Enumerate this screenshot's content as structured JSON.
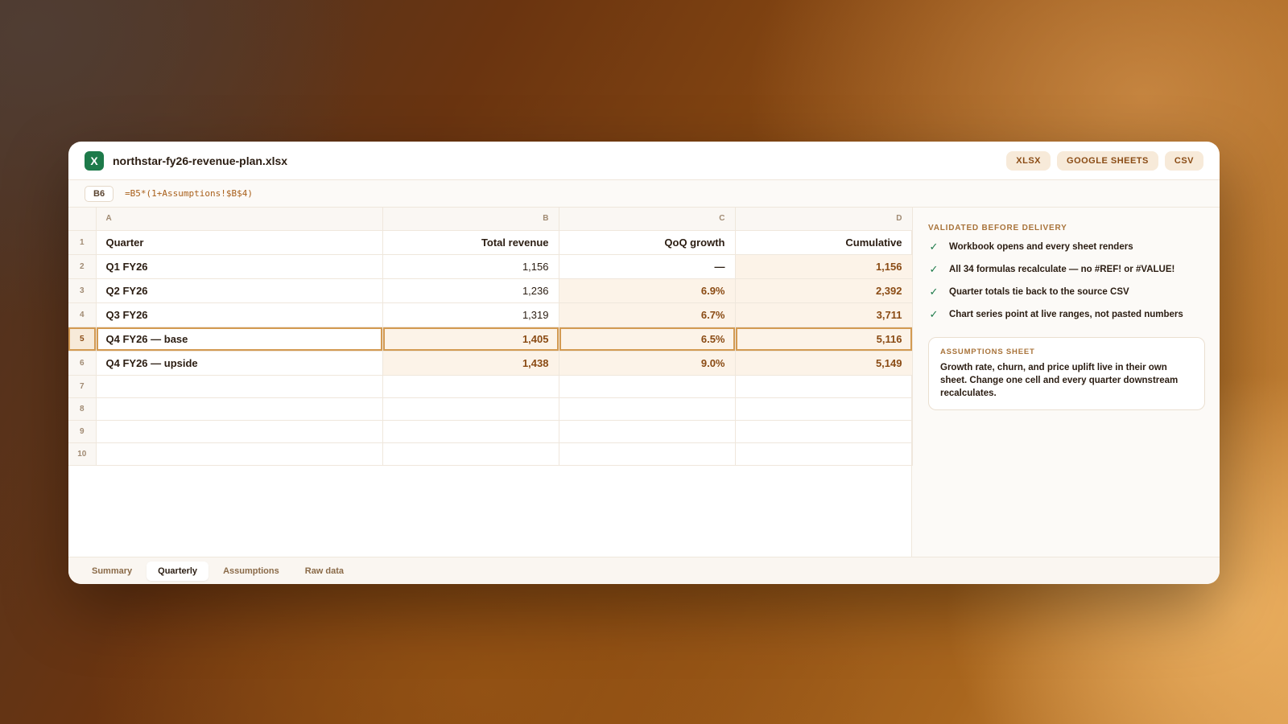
{
  "window": {
    "app_icon": "X",
    "filename": "northstar-fy26-revenue-plan.xlsx",
    "exports": [
      "XLSX",
      "GOOGLE SHEETS",
      "CSV"
    ]
  },
  "formula_bar": {
    "cell_ref": "B6",
    "formula": "=B5*(1+Assumptions!$B$4)"
  },
  "grid": {
    "columns": [
      "A",
      "B",
      "C",
      "D"
    ],
    "header_row": {
      "num": "1",
      "cells": [
        "Quarter",
        "Total revenue",
        "QoQ growth",
        "Cumulative"
      ]
    },
    "rows": [
      {
        "num": "2",
        "cells": [
          "Q1 FY26",
          "1,156",
          "—",
          "1,156"
        ]
      },
      {
        "num": "3",
        "cells": [
          "Q2 FY26",
          "1,236",
          "6.9%",
          "2,392"
        ]
      },
      {
        "num": "4",
        "cells": [
          "Q3 FY26",
          "1,319",
          "6.7%",
          "3,711"
        ]
      },
      {
        "num": "5",
        "cells": [
          "Q4 FY26 — base",
          "1,405",
          "6.5%",
          "5,116"
        ]
      },
      {
        "num": "6",
        "cells": [
          "Q4 FY26 — upside",
          "1,438",
          "9.0%",
          "5,149"
        ]
      }
    ],
    "empty_rows": [
      "7",
      "8",
      "9",
      "10"
    ]
  },
  "side": {
    "heading": "VALIDATED BEFORE DELIVERY",
    "checks": [
      "Workbook opens and every sheet renders",
      "All 34 formulas recalculate — no #REF! or #VALUE!",
      "Quarter totals tie back to the source CSV",
      "Chart series point at live ranges, not pasted numbers"
    ],
    "card": {
      "title": "ASSUMPTIONS SHEET",
      "body": "Growth rate, churn, and price uplift live in their own sheet. Change one cell and every quarter downstream recalculates."
    }
  },
  "tabs": [
    "Summary",
    "Quarterly",
    "Assumptions",
    "Raw data"
  ],
  "colors": {
    "accent": "#d39a52",
    "brand_green": "#1d7a4a",
    "tint": "#fcf3e8"
  }
}
